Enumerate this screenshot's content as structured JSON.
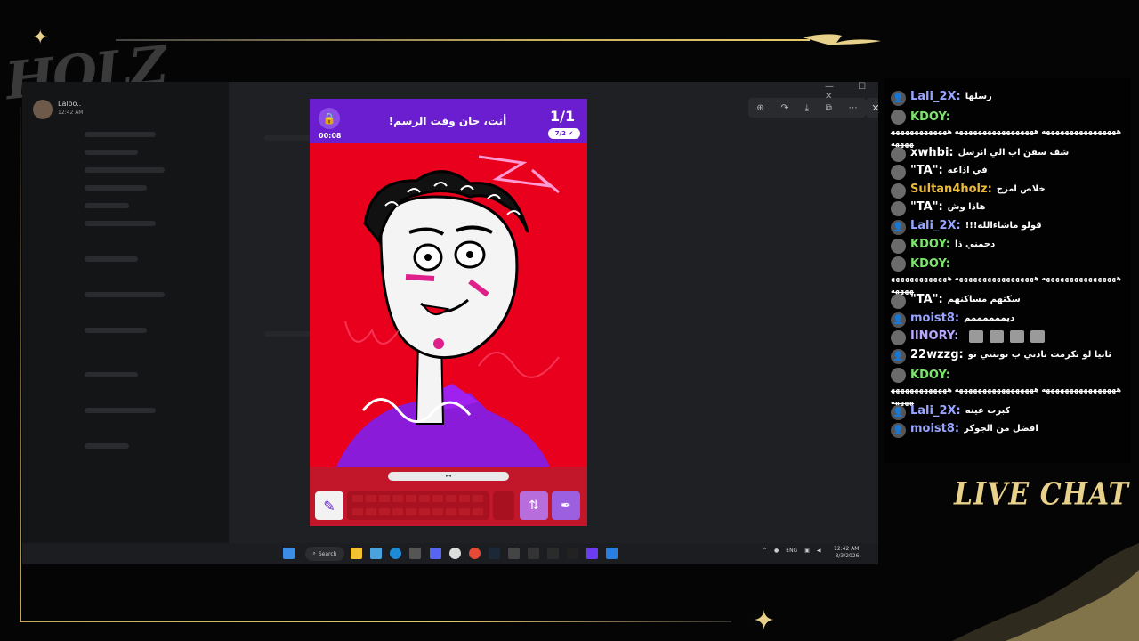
{
  "overlay": {
    "logo": "HOLZ",
    "live_chat_label": "LIVE CHAT",
    "accent_color": "#e8d18a"
  },
  "discord": {
    "user_name": "Laloo..",
    "time": "12:42 AM",
    "window_controls": "— ☐ ✕",
    "viewer_tools": [
      "zoom-in-icon",
      "forward-icon",
      "download-icon",
      "open-external-icon",
      "more-icon"
    ]
  },
  "game": {
    "timer": "00:08",
    "prompt": "أنت، حان وقت الرسم!",
    "round": "1/1",
    "players": "7/2",
    "lock_icon": "lock-icon",
    "colors": {
      "header": "#6a1ed0",
      "canvas": "#e8001c",
      "toolbar": "#c2162a"
    }
  },
  "taskbar": {
    "search_label": "Search",
    "language": "ENG",
    "clock_time": "12:42 AM",
    "clock_date": "8/3/2026"
  },
  "chat": {
    "messages": [
      {
        "user": "Lali_2X:",
        "color": "#9aa4ff",
        "text": "رسلها",
        "badge": "user-icon"
      },
      {
        "user": "KDOY:",
        "color": "#7ee36e",
        "text": "ههههههههههههههههه هههههههههههههههههه هههههههههههههههههه",
        "badge": "avatar",
        "wrap": true
      },
      {
        "user": "xwhbi:",
        "color": "#ffffff",
        "text": "شف سفن اب الي انرسل",
        "badge": "avatar"
      },
      {
        "user": "\"TA\":",
        "color": "#ffffff",
        "text": "في اذاعه",
        "badge": "avatar"
      },
      {
        "user": "Sultan4holz:",
        "color": "#e8b93a",
        "text": "خلاص امزح",
        "badge": "avatar"
      },
      {
        "user": "\"TA\":",
        "color": "#ffffff",
        "text": "هاذا وش",
        "badge": "avatar"
      },
      {
        "user": "Lali_2X:",
        "color": "#9aa4ff",
        "text": "قولو ماشاءالله!!!",
        "badge": "user-icon"
      },
      {
        "user": "KDOY:",
        "color": "#7ee36e",
        "text": "دحمني ذا",
        "badge": "avatar"
      },
      {
        "user": "KDOY:",
        "color": "#7ee36e",
        "text": "ههههههههههههههههه هههههههههههههههههه هههههههههههههههههه",
        "badge": "avatar",
        "wrap": true
      },
      {
        "user": "\"TA\":",
        "color": "#ffffff",
        "text": "سكتهم مساكنهم",
        "badge": "avatar"
      },
      {
        "user": "moist8:",
        "color": "#9aa4ff",
        "text": "ديممممممم",
        "badge": "user-icon"
      },
      {
        "user": "IINORY:",
        "color": "#b8a6ff",
        "text": "",
        "badge": "avatar",
        "emotes": 4
      },
      {
        "user": "22wzzg:",
        "color": "#ffffff",
        "text": "ثانيا لو تكرمت نادني ب تونتني تو",
        "badge": "user-icon"
      },
      {
        "user": "KDOY:",
        "color": "#7ee36e",
        "text": "ههههههههههههههههه هههههههههههههههههه هههههههههههههههههه",
        "badge": "avatar",
        "wrap": true
      },
      {
        "user": "Lali_2X:",
        "color": "#9aa4ff",
        "text": "كبرت عينه",
        "badge": "user-icon"
      },
      {
        "user": "moist8:",
        "color": "#9aa4ff",
        "text": "افضل من الجوكر",
        "badge": "user-icon"
      }
    ]
  }
}
